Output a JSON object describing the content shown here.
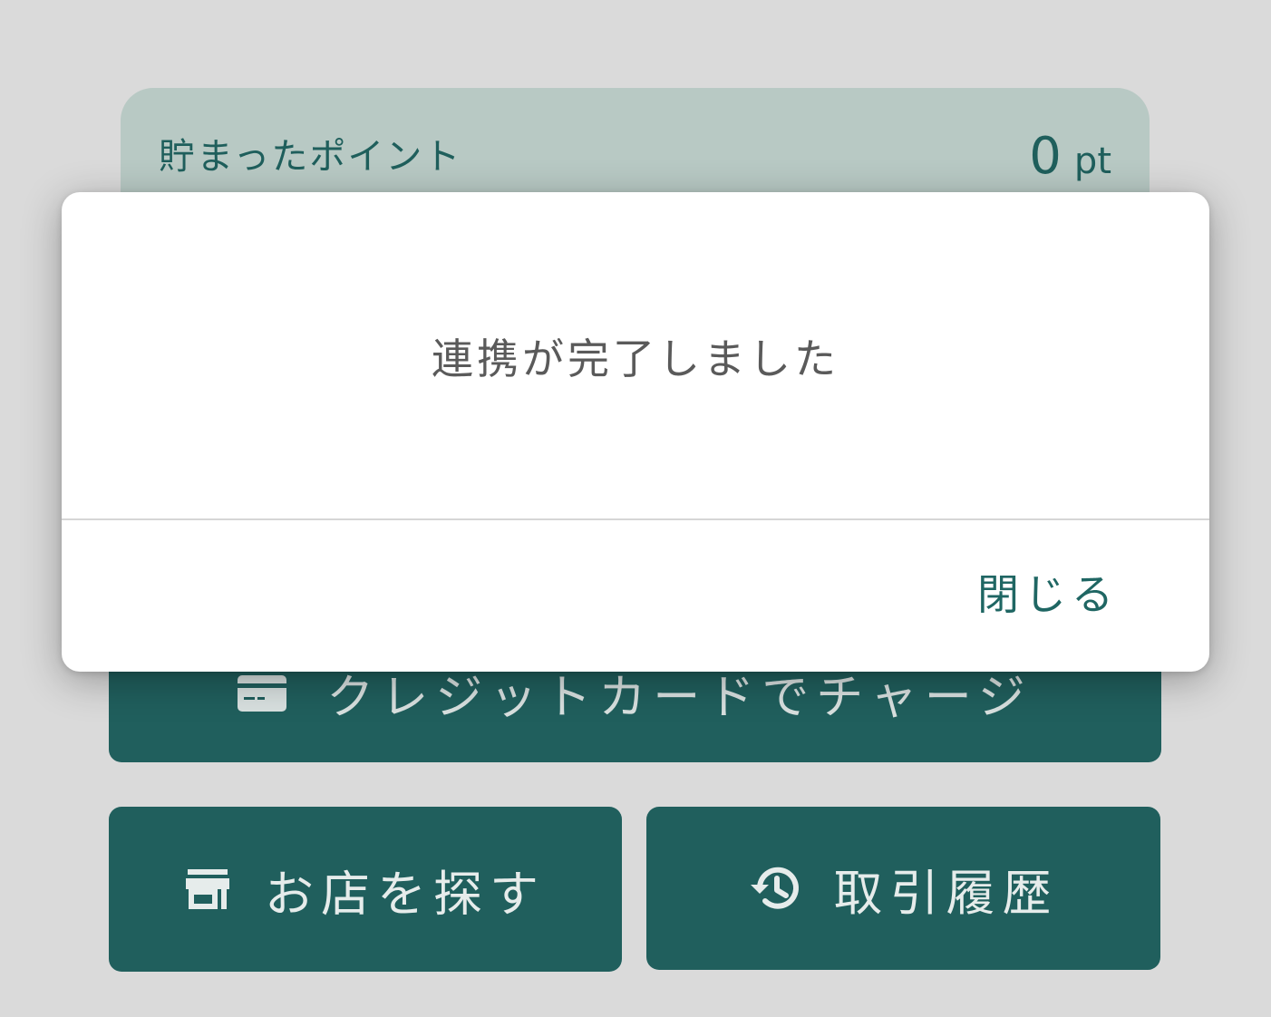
{
  "points_card": {
    "label": "貯まったポイント",
    "value": "0",
    "unit": "pt"
  },
  "buttons": {
    "charge": {
      "label": "クレジットカードでチャージ",
      "icon": "credit-card-icon"
    },
    "shop": {
      "label": "お店を探す",
      "icon": "store-icon"
    },
    "history": {
      "label": "取引履歴",
      "icon": "history-icon"
    }
  },
  "dialog": {
    "message": "連携が完了しました",
    "close_label": "閉じる"
  },
  "colors": {
    "accent": "#205f5d",
    "card_background": "#b8c9c4",
    "page_background": "#dadada",
    "dialog_background": "#ffffff"
  }
}
